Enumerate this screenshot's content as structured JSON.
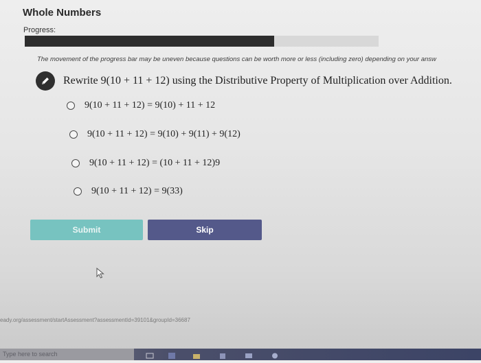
{
  "header": {
    "app_title": "Whole Numbers",
    "progress_label": "Progress:",
    "progress_fraction": 0.705,
    "progress_note": "The movement of the progress bar may be uneven because questions can be worth more or less (including zero) depending on your answ"
  },
  "question": {
    "text": "Rewrite 9(10 + 11 + 12) using the Distributive Property of Multiplication over Addition.",
    "options": [
      "9(10 + 11 + 12) = 9(10) + 11 + 12",
      "9(10 + 11 + 12) = 9(10) + 9(11) + 9(12)",
      "9(10 + 11 + 12) = (10 + 11 + 12)9",
      "9(10 + 11 + 12) = 9(33)"
    ]
  },
  "buttons": {
    "submit_label": "Submit",
    "skip_label": "Skip"
  },
  "status_bar": {
    "url": "eady.org/assessment/startAssessment?assessmentId=39101&groupId=36687"
  },
  "taskbar": {
    "search_placeholder": "Type here to search"
  },
  "colors": {
    "submit": "#77c3c0",
    "skip": "#54598a",
    "progress_fill": "#2d2d2d"
  }
}
